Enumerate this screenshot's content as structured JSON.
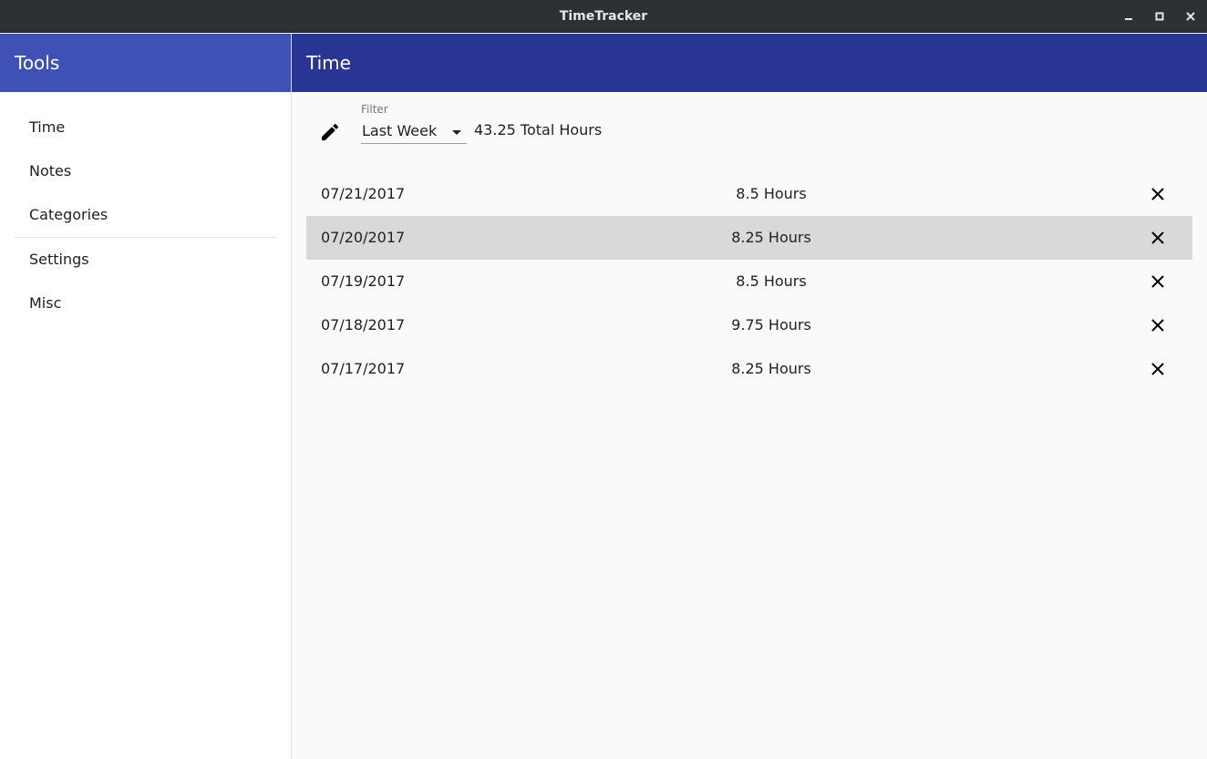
{
  "window": {
    "title": "TimeTracker",
    "minimize_icon": "minimize-icon",
    "maximize_icon": "maximize-icon",
    "close_icon": "close-icon"
  },
  "sidebar": {
    "title": "Tools",
    "items": [
      {
        "label": "Time"
      },
      {
        "label": "Notes"
      },
      {
        "label": "Categories"
      },
      {
        "label": "Settings"
      },
      {
        "label": "Misc"
      }
    ]
  },
  "main": {
    "title": "Time",
    "edit_icon": "pencil-icon",
    "filter": {
      "label": "Filter",
      "selected": "Last Week"
    },
    "total": "43.25 Total Hours",
    "entries": [
      {
        "date": "07/21/2017",
        "hours": "8.5 Hours",
        "selected": false
      },
      {
        "date": "07/20/2017",
        "hours": "8.25 Hours",
        "selected": true
      },
      {
        "date": "07/19/2017",
        "hours": "8.5 Hours",
        "selected": false
      },
      {
        "date": "07/18/2017",
        "hours": "9.75 Hours",
        "selected": false
      },
      {
        "date": "07/17/2017",
        "hours": "8.25 Hours",
        "selected": false
      }
    ],
    "delete_icon": "close-icon"
  },
  "colors": {
    "titlebar": "#2d3134",
    "sidebar_header": "#3f51b5",
    "main_header": "#283593",
    "selected_row": "#d9d9d9"
  }
}
